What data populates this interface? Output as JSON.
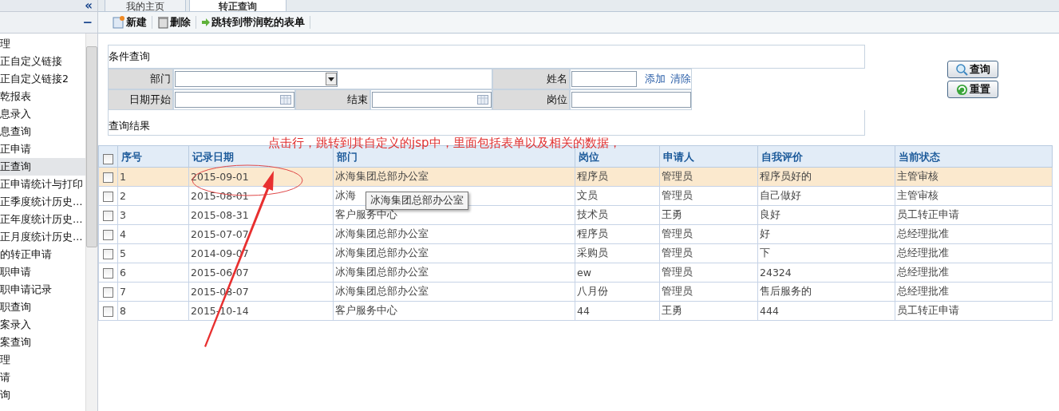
{
  "sidebar": {
    "collapse_label": "«",
    "section_toggle": "−",
    "items": [
      {
        "label": "理",
        "selected": false
      },
      {
        "label": "正自定义链接",
        "selected": false
      },
      {
        "label": "正自定义链接2",
        "selected": false
      },
      {
        "label": "乾报表",
        "selected": false
      },
      {
        "label": "息录入",
        "selected": false
      },
      {
        "label": "息查询",
        "selected": false
      },
      {
        "label": "正申请",
        "selected": false
      },
      {
        "label": "正查询",
        "selected": true
      },
      {
        "label": "正申请统计与打印",
        "selected": false
      },
      {
        "label": "正季度统计历史…",
        "selected": false
      },
      {
        "label": "正年度统计历史…",
        "selected": false
      },
      {
        "label": "正月度统计历史…",
        "selected": false
      },
      {
        "label": "的转正申请",
        "selected": false
      },
      {
        "label": "职申请",
        "selected": false
      },
      {
        "label": "职申请记录",
        "selected": false
      },
      {
        "label": "职查询",
        "selected": false
      },
      {
        "label": "案录入",
        "selected": false
      },
      {
        "label": "案查询",
        "selected": false
      },
      {
        "label": "理",
        "selected": false
      },
      {
        "label": "请",
        "selected": false
      },
      {
        "label": "询",
        "selected": false
      }
    ]
  },
  "tabs": [
    {
      "label": "我的主页",
      "selected": false
    },
    {
      "label": "转正查询",
      "selected": true
    }
  ],
  "toolbar": [
    {
      "label": "新建",
      "kind": "new"
    },
    {
      "label": "删除",
      "kind": "delete"
    },
    {
      "label": "跳转到带润乾的表单",
      "kind": "jump"
    }
  ],
  "search_form": {
    "title": "条件查询",
    "department": {
      "label": "部门"
    },
    "name": {
      "label": "姓名"
    },
    "add_link": "添加",
    "clear_link": "清除",
    "date_start": {
      "label": "日期开始"
    },
    "date_end": {
      "label": "结束"
    },
    "position": {
      "label": "岗位"
    },
    "results_title": "查询结果",
    "buttons": [
      {
        "label": "查询",
        "kind": "search"
      },
      {
        "label": "重置",
        "kind": "reset"
      }
    ]
  },
  "table": {
    "select_all_checked": false,
    "columns": [
      "序号",
      "记录日期",
      "部门",
      "岗位",
      "申请人",
      "自我评价",
      "当前状态"
    ],
    "rows": [
      {
        "checked": false,
        "selected": true,
        "cells": [
          "1",
          "2015-09-01",
          "冰海集团总部办公室",
          "程序员",
          "管理员",
          "程序员好的",
          "主管审核"
        ]
      },
      {
        "checked": false,
        "selected": false,
        "cells": [
          "2",
          "2015-08-01",
          "冰海",
          "文员",
          "管理员",
          "自己做好",
          "主管审核"
        ]
      },
      {
        "checked": false,
        "selected": false,
        "cells": [
          "3",
          "2015-08-31",
          "客户服务中心",
          "技术员",
          "王勇",
          "良好",
          "员工转正申请"
        ]
      },
      {
        "checked": false,
        "selected": false,
        "cells": [
          "4",
          "2015-07-07",
          "冰海集团总部办公室",
          "程序员",
          "管理员",
          "好",
          "总经理批准"
        ]
      },
      {
        "checked": false,
        "selected": false,
        "cells": [
          "5",
          "2014-09-07",
          "冰海集团总部办公室",
          "采购员",
          "管理员",
          "下",
          "总经理批准"
        ]
      },
      {
        "checked": false,
        "selected": false,
        "cells": [
          "6",
          "2015-06-07",
          "冰海集团总部办公室",
          "ew",
          "管理员",
          "24324",
          "总经理批准"
        ]
      },
      {
        "checked": false,
        "selected": false,
        "cells": [
          "7",
          "2015-08-07",
          "冰海集团总部办公室",
          "八月份",
          "管理员",
          "售后服务的",
          "总经理批准"
        ]
      },
      {
        "checked": false,
        "selected": false,
        "cells": [
          "8",
          "2015-10-14",
          "客户服务中心",
          "44",
          "王勇",
          "444",
          "员工转正申请"
        ]
      }
    ]
  },
  "tooltip": "冰海集团总部办公室",
  "annotation": "点击行，跳转到其自定义的jsp中，里面包括表单以及相关的数据，"
}
